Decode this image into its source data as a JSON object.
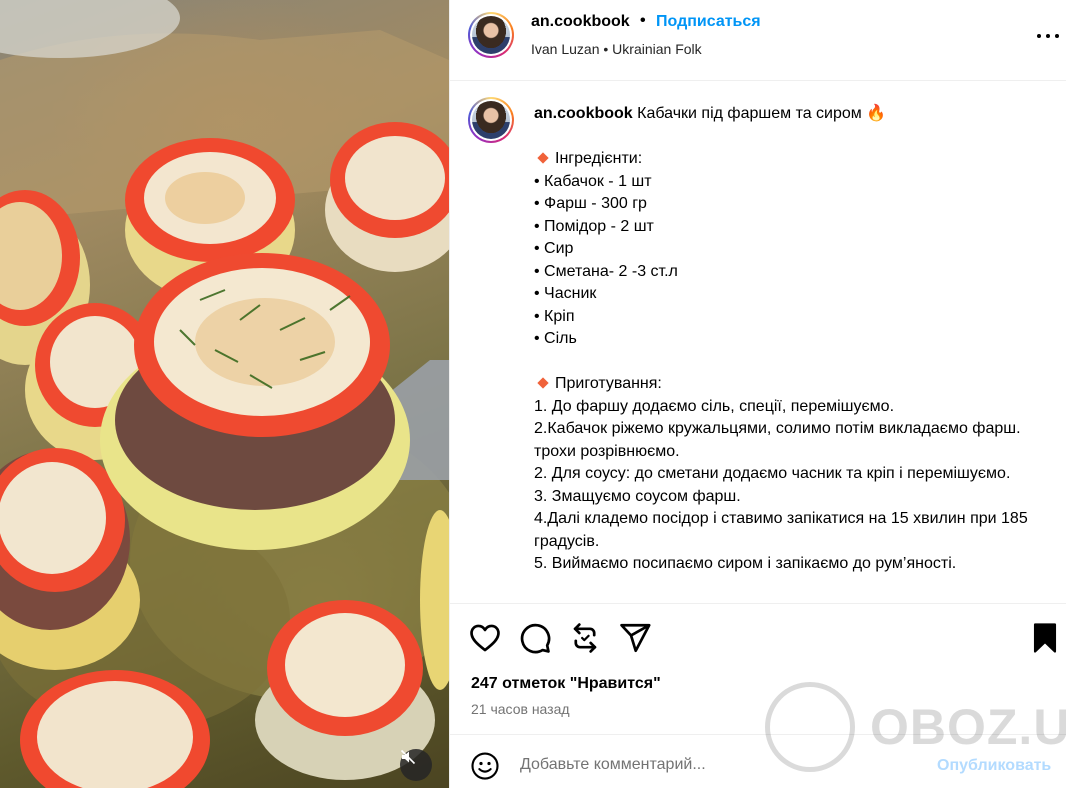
{
  "media": {
    "description_icon": "mute-icon"
  },
  "header": {
    "username": "an.cookbook",
    "separator": "•",
    "follow_label": "Подписаться",
    "audio": "Ivan Luzan • Ukrainian Folk",
    "more_icon": "more-options-icon"
  },
  "caption": {
    "username": "an.cookbook",
    "title": "Кабачки під фаршем та сиром",
    "title_emoji": "🔥",
    "ingredients_heading": "Інгредієнти:",
    "ingredients": [
      "• Кабачок - 1 шт",
      "• Фарш - 300 гр",
      "• Помідор - 2 шт",
      "• Сир",
      "• Сметана- 2 -3 ст.л",
      "• Часник",
      "• Кріп",
      "• Сіль"
    ],
    "steps_heading": "Приготування:",
    "steps": [
      "1. До фаршу додаємо сіль, спеції, перемішуємо.",
      "2.Кабачок ріжемо кружальцями, солимо потім викладаємо фарш. трохи розрівнюємо.",
      "2. Для соусу: до сметани додаємо часник та кріп і перемішуємо.",
      "3. Змащуємо соусом фарш.",
      "4.Далі кладемо посідор і ставимо запікатися на 15 хвилин при 185 градусів.",
      "5. Виймаємо посипаємо сиром і запікаємо до рум’яності."
    ],
    "accent_color": "#f0623a"
  },
  "actions": {
    "like_icon": "heart-icon",
    "comment_icon": "comment-icon",
    "share_icon": "repost-icon",
    "send_icon": "send-icon",
    "save_icon": "bookmark-icon",
    "likes_text": "247 отметок \"Нравится\"",
    "time_text": "21 часов назад"
  },
  "watermark": {
    "text": "OBOZ.UA"
  },
  "comment": {
    "placeholder": "Добавьте комментарий...",
    "publish_label": "Опубликовать",
    "emoji_icon": "emoji-icon"
  },
  "colors": {
    "link": "#0095f6",
    "publish_disabled": "#b3dbff",
    "secondary_text": "#737373",
    "divider": "#efefef"
  }
}
